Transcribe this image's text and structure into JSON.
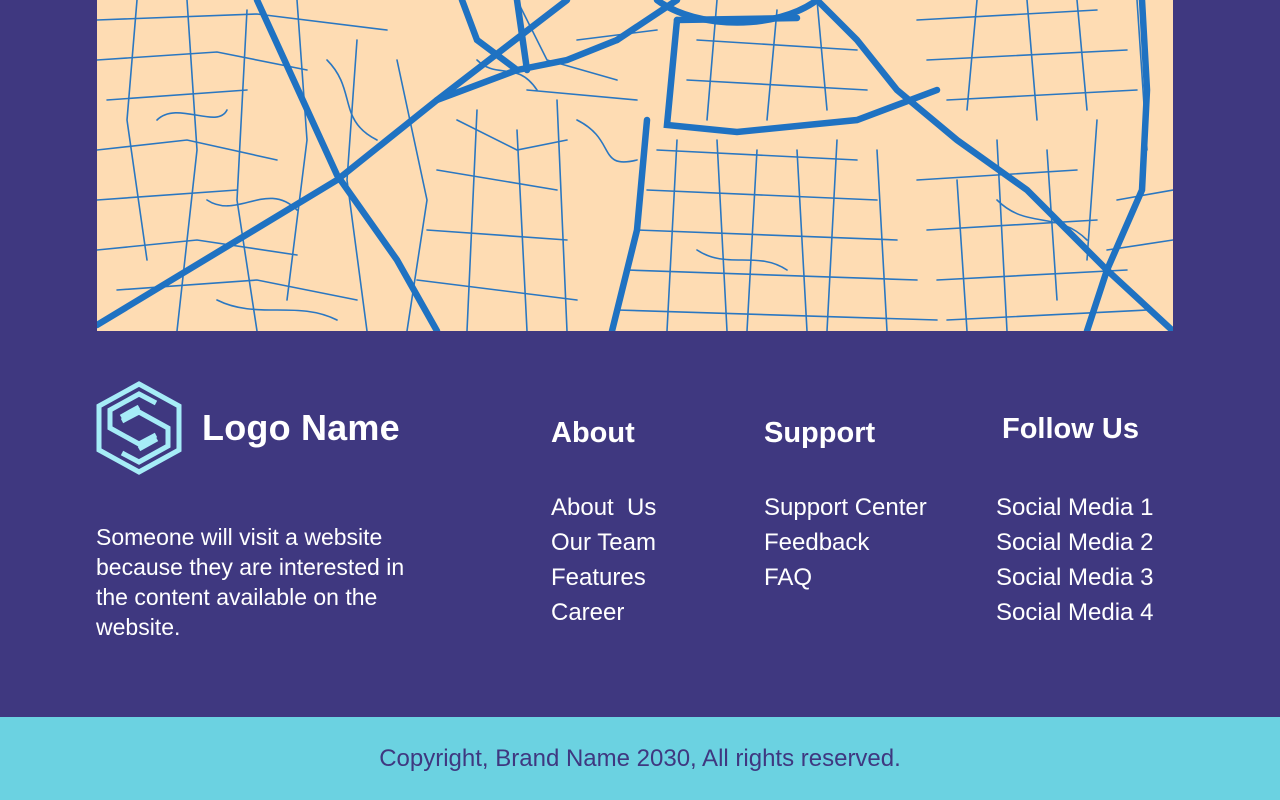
{
  "brand": {
    "logo_name": "Logo Name",
    "logo_icon": "hexagon-s-icon",
    "tagline": "Someone will visit a website because they are interested in the content available on the website."
  },
  "columns": {
    "about": {
      "title": "About",
      "items": [
        "About  Us",
        "Our Team",
        "Features",
        "Career"
      ]
    },
    "support": {
      "title": "Support",
      "items": [
        "Support Center",
        "Feedback",
        "FAQ"
      ]
    },
    "follow": {
      "title": "Follow Us",
      "items": [
        "Social Media 1",
        "Social Media 2",
        "Social Media 3",
        "Social Media 4"
      ]
    }
  },
  "footer": {
    "copyright": "Copyright, Brand Name 2030, All rights reserved."
  },
  "colors": {
    "background": "#3f3880",
    "map_land": "#fedcb3",
    "map_roads": "#1f72c2",
    "logo_accent": "#a6ecf7",
    "footer_bar": "#6bd2e1",
    "text": "#ffffff"
  }
}
